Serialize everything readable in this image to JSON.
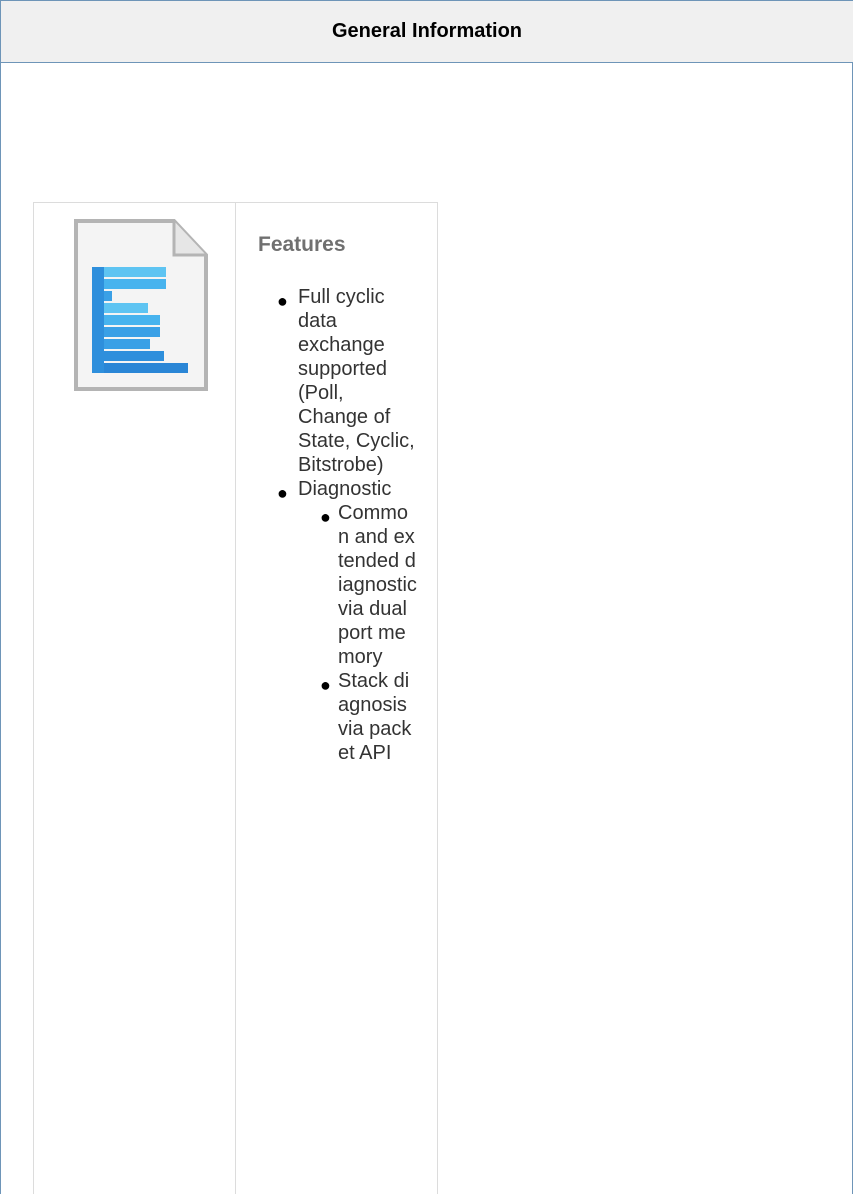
{
  "header": {
    "title": "General Information"
  },
  "icon": {
    "name": "document-icon"
  },
  "features": {
    "heading": "Features",
    "items": [
      {
        "text": "Full cyclic data exchange supported (Poll, Change of State, Cyclic, Bitstrobe)"
      },
      {
        "text": "Diagnostic",
        "subitems": [
          {
            "text": "Common and extended diagnostic via dual port memory"
          },
          {
            "text": "Stack diagnosis via packet API"
          }
        ]
      }
    ]
  },
  "colors": {
    "border": "#6e95b8",
    "header_bg": "#f0f0f0",
    "heading": "#707070",
    "icon_blue": "#3aa0e6"
  }
}
